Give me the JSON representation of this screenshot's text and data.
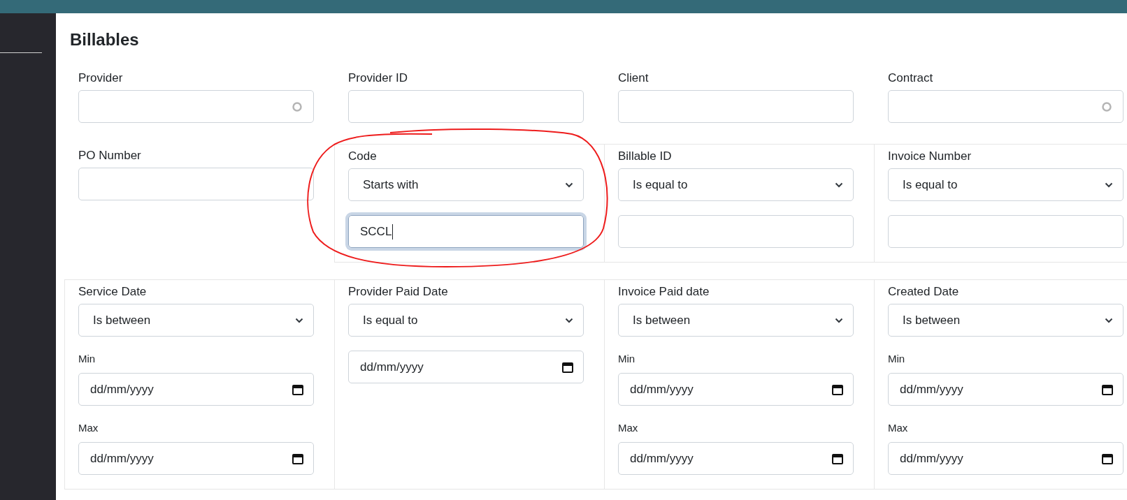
{
  "title": "Billables",
  "rows": [
    {
      "fields": [
        {
          "kind": "text",
          "label": "Provider",
          "loading": true,
          "focused": false
        },
        {
          "kind": "text",
          "label": "Provider ID",
          "loading": false,
          "focused": false
        },
        {
          "kind": "text",
          "label": "Client",
          "loading": false,
          "focused": false
        },
        {
          "kind": "text",
          "label": "Contract",
          "loading": true,
          "focused": false
        }
      ]
    },
    {
      "fields": [
        {
          "kind": "text",
          "label": "PO Number",
          "loading": false,
          "focused": false
        },
        {
          "kind": "text_filter",
          "label": "Code",
          "operator": "Starts with",
          "value": "SCCL",
          "focused": true
        },
        {
          "kind": "text_filter",
          "label": "Billable ID",
          "operator": "Is equal to",
          "focused": false
        },
        {
          "kind": "text_filter",
          "label": "Invoice Number",
          "operator": "Is equal to",
          "focused": false
        }
      ]
    },
    {
      "fields": [
        {
          "kind": "date_range",
          "label": "Service Date",
          "operator": "Is between",
          "min_label": "Min",
          "min_placeholder": "dd/mm/yyyy",
          "max_label": "Max",
          "max_placeholder": "dd/mm/yyyy"
        },
        {
          "kind": "date_single",
          "label": "Provider Paid Date",
          "operator": "Is equal to",
          "placeholder": "dd/mm/yyyy"
        },
        {
          "kind": "date_range",
          "label": "Invoice Paid date",
          "operator": "Is between",
          "min_label": "Min",
          "min_placeholder": "dd/mm/yyyy",
          "max_label": "Max",
          "max_placeholder": "dd/mm/yyyy"
        },
        {
          "kind": "date_range",
          "label": "Created Date",
          "operator": "Is between",
          "min_label": "Min",
          "min_placeholder": "dd/mm/yyyy",
          "max_label": "Max",
          "max_placeholder": "dd/mm/yyyy"
        }
      ]
    }
  ]
}
